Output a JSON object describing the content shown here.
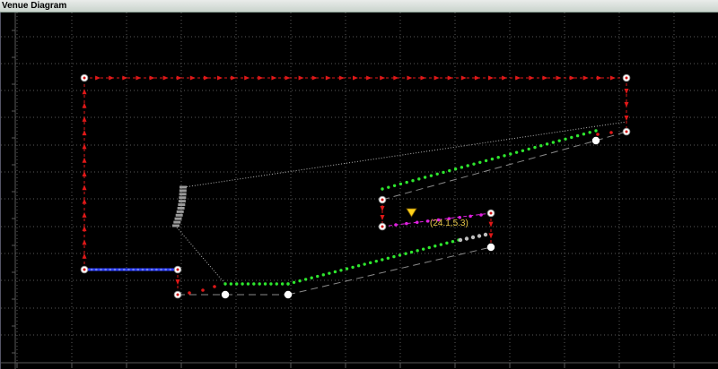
{
  "window": {
    "title": "Venue Diagram"
  },
  "cursor_readout": "(24.1,5.3)",
  "colors": {
    "background": "#000000",
    "grid": "#5a5a5a",
    "perimeter_marker": "#e01818",
    "blue_section": "#2a3cff",
    "green_rows": "#2ee62e",
    "magenta_section": "#e020e0",
    "dashed_guide": "#8a8a8a",
    "dotted_guide": "#b5b5b5",
    "node_fill": "#ffffff",
    "cursor_marker": "#ffd21a"
  },
  "icons": {
    "vertex": "ring-node-icon",
    "anchor": "filled-node-icon",
    "cursor": "down-triangle-icon"
  }
}
